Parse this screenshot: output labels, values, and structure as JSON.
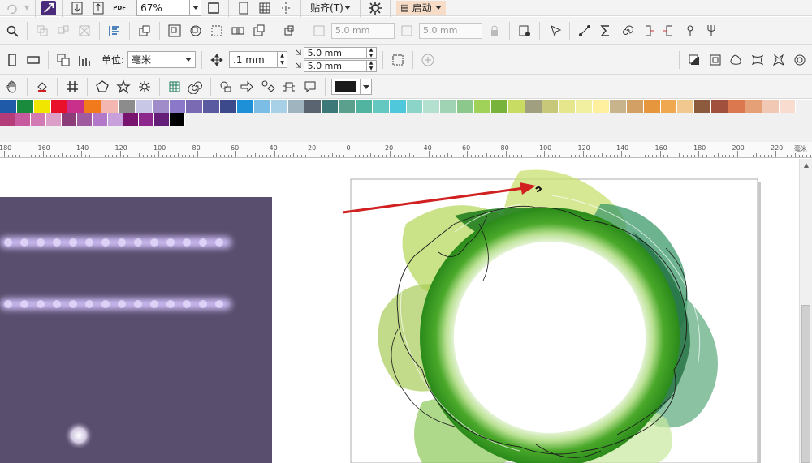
{
  "toolbar1": {
    "zoom": "67%",
    "pdf_label": "PDF",
    "snap_label": "贴齐(T)",
    "launch_label": "启动"
  },
  "toolbar2": {
    "dup_x": "5.0 mm",
    "dup_y": "5.0 mm"
  },
  "toolbar3": {
    "unit_label": "单位:",
    "unit_value": "毫米",
    "nudge_value": ".1 mm",
    "micro_x": "5.0 mm",
    "micro_y": "5.0 mm"
  },
  "palette": {
    "row1": [
      "#1f5aa8",
      "#1a8a3c",
      "#f0e600",
      "#e8102a",
      "#c8308c",
      "#f07a1c",
      "#f4b6b0",
      "#8c8c8c",
      "#c8c8e6",
      "#a08cc8",
      "#8c78c8",
      "#7a6ab4",
      "#5a5aa0",
      "#3c4a8c",
      "#1e90d8",
      "#7cbde6",
      "#a8d0e6",
      "#a0b4c0",
      "#5a6470",
      "#3c7878",
      "#5aa08c",
      "#50b4a0",
      "#64c8c0",
      "#50c8dc",
      "#8cd4c8",
      "#b4e0d0",
      "#a0d2b4",
      "#8cc88c",
      "#a0d25a",
      "#78b43c",
      "#c8dc64",
      "#a0a080",
      "#c8c87a",
      "#e6e68c",
      "#f0f0a0",
      "#fff0a0",
      "#c8b48c",
      "#d2a064",
      "#e6963c",
      "#f0a850",
      "#f0c890",
      "#8c5a3c",
      "#a0503c",
      "#dc7850",
      "#e6a078",
      "#f0c8b4",
      "#f8dcd0"
    ],
    "row2": [
      "#b43c78",
      "#c85aa0",
      "#d27ab4",
      "#dca0c8",
      "#8c3c78",
      "#a05aa0",
      "#b478c8",
      "#c8a0dc",
      "#78146e",
      "#8c288c",
      "#641e78",
      "#000000"
    ]
  },
  "ruler": {
    "labels": [
      "180",
      "160",
      "140",
      "120",
      "100",
      "80",
      "60",
      "40",
      "20",
      "0",
      "20",
      "40",
      "60",
      "80",
      "100",
      "120",
      "140",
      "160",
      "180",
      "200",
      "220"
    ],
    "unit": "毫米"
  },
  "colors": {
    "left_panel": "#5a4e6e",
    "arrow": "#d02020",
    "outline_fill": "#1a1a1a"
  }
}
